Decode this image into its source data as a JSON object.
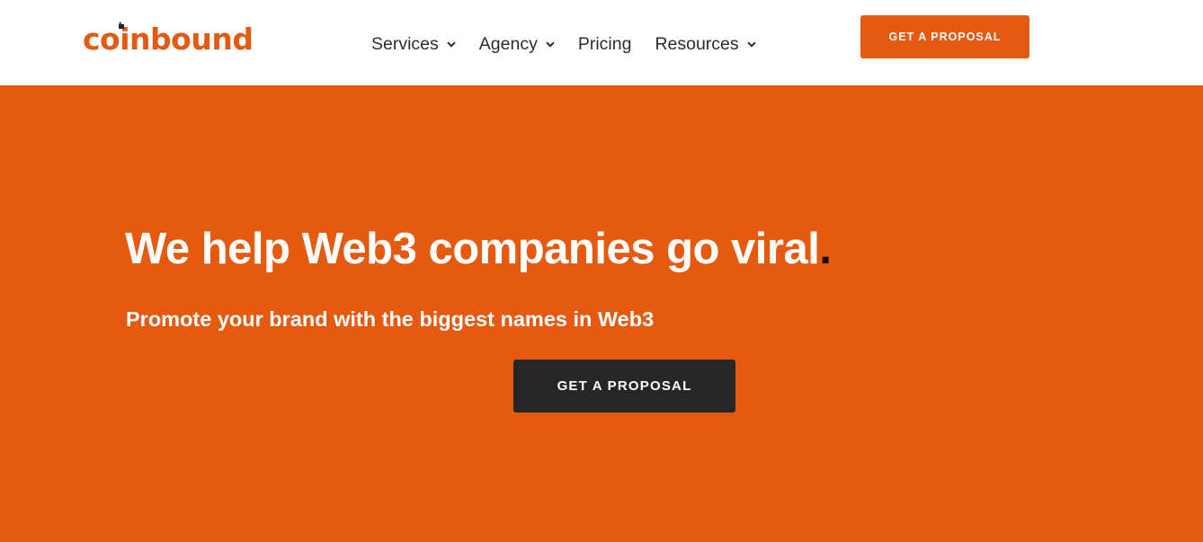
{
  "header": {
    "logo_text": "coinbound",
    "nav": [
      {
        "label": "Services",
        "has_dropdown": true,
        "icon": "chevron-down-icon"
      },
      {
        "label": "Agency",
        "has_dropdown": true,
        "icon": "chevron-down-icon"
      },
      {
        "label": "Pricing",
        "has_dropdown": false
      },
      {
        "label": "Resources",
        "has_dropdown": true,
        "icon": "chevron-down-icon"
      }
    ],
    "cta_label": "GET A PROPOSAL"
  },
  "hero": {
    "headline": "We help Web3 companies go viral",
    "headline_dot": ".",
    "subheadline": "Promote your brand with the biggest names in Web3",
    "cta_label": "GET A PROPOSAL"
  },
  "colors": {
    "brand_orange": "#e55a11",
    "hero_background": "#e65a10",
    "dark_button": "#262626",
    "nav_text": "#2c2c2c"
  }
}
